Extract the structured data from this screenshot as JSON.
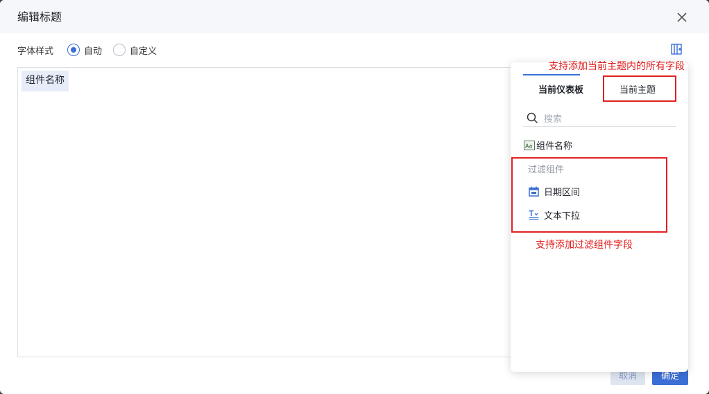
{
  "dialog": {
    "title": "编辑标题",
    "font_style": {
      "label": "字体样式",
      "options": [
        {
          "label": "自动",
          "checked": true
        },
        {
          "label": "自定义",
          "checked": false
        }
      ]
    },
    "editor_chip": "组件名称",
    "buttons": {
      "cancel": "取消",
      "ok": "确定"
    }
  },
  "panel": {
    "tabs": [
      "当前仪表板",
      "当前主题"
    ],
    "search_placeholder": "搜索",
    "fields": [
      {
        "label": "组件名称",
        "icon": "text-field-icon"
      }
    ],
    "filter_group": {
      "title": "过滤组件",
      "items": [
        {
          "label": "日期区间",
          "icon": "calendar-icon"
        },
        {
          "label": "文本下拉",
          "icon": "text-dropdown-icon"
        }
      ]
    }
  },
  "annotations": {
    "top": "支持添加当前主题内的所有字段",
    "bottom": "支持添加过滤组件字段"
  },
  "colors": {
    "accent": "#3b6fd6",
    "annotation": "#e02020"
  }
}
